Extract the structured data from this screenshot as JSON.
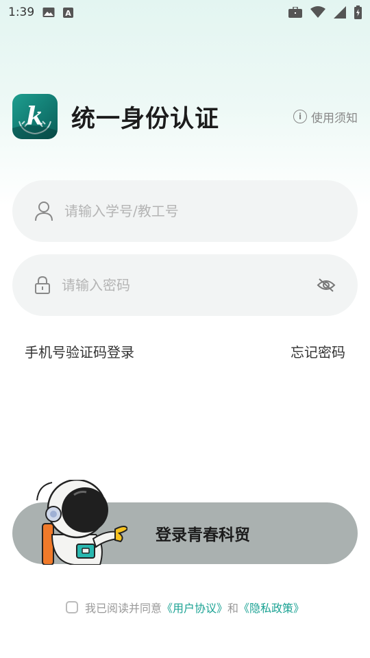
{
  "status_bar": {
    "time": "1:39",
    "icons_left": [
      "image-icon",
      "text-a-icon"
    ],
    "icons_right": [
      "briefcase-icon",
      "wifi-icon",
      "signal-icon",
      "battery-icon"
    ]
  },
  "header": {
    "title": "统一身份认证",
    "logo_letter": "k",
    "notice_label": "使用须知"
  },
  "form": {
    "username_placeholder": "请输入学号/教工号",
    "username_value": "",
    "password_placeholder": "请输入密码",
    "password_value": ""
  },
  "links": {
    "sms_login": "手机号验证码登录",
    "forgot_password": "忘记密码"
  },
  "login_button": {
    "label": "登录青春科贸"
  },
  "agreement": {
    "checked": false,
    "prefix": "我已阅读并同意",
    "user_agreement": "《用户协议》",
    "and": "和",
    "privacy_policy": "《隐私政策》"
  },
  "colors": {
    "accent": "#1aa293",
    "button_bg": "#aab1b0",
    "field_bg": "#f2f4f4"
  }
}
